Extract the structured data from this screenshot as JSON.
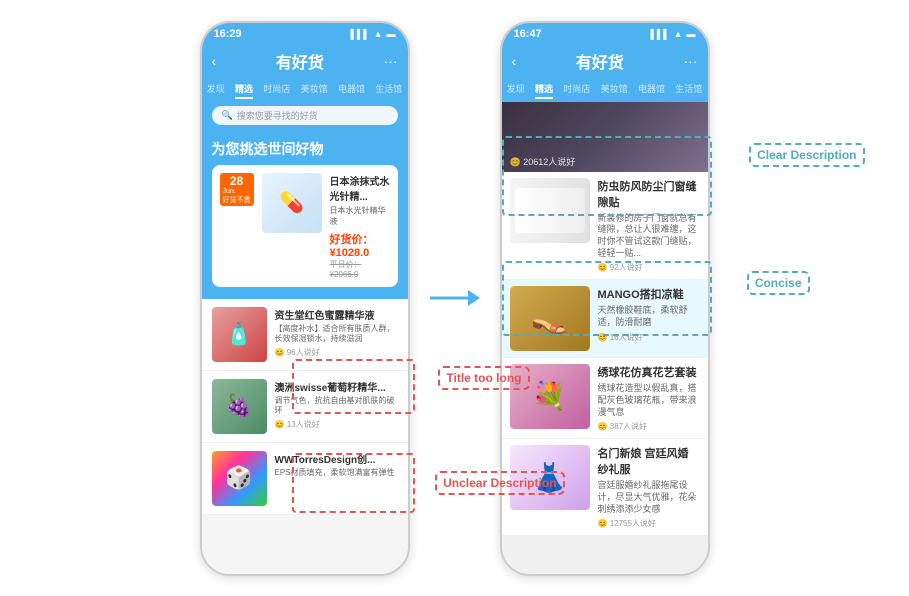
{
  "leftPhone": {
    "statusTime": "16:29",
    "navTitle": "有好货",
    "tabs": [
      "发现",
      "精选",
      "时尚店",
      "美妆馆",
      "电器馆",
      "生活馆"
    ],
    "activeTab": "精选",
    "searchPlaceholder": "搜索您要寻找的好货",
    "heroTitle": "为您挑选世间好物",
    "badge": {
      "day": "28",
      "month": "Jun.",
      "label": "好货不贵"
    },
    "featuredProduct": {
      "name": "日本涂抹式水光针精...",
      "sub": "日本水光针精华液",
      "priceLabel": "好货价：",
      "price": "¥1028.0",
      "originalPrice": "平日价：¥2066.0"
    },
    "products": [
      {
        "name": "资生堂红色蜜露精华液",
        "desc": "【高度补水】适合所有肤质人群，长效保湿锁水，持续滋润",
        "likes": "96人说好",
        "thumbType": "red-bottle",
        "emoji": "🧴"
      },
      {
        "name": "澳洲swisse葡萄籽精华...",
        "desc": "调节气色，抗抗自由基对肌肤的破环",
        "likes": "13人说好",
        "thumbType": "green-bottle",
        "emoji": "🍇"
      },
      {
        "name": "WWTorresDesign创...",
        "desc": "EPS材质填充，柔软饱满富有弹性",
        "likes": "",
        "thumbType": "colorful-cube",
        "emoji": "🎲"
      }
    ],
    "annotations": [
      {
        "text": "Title too long",
        "type": "red"
      },
      {
        "text": "Unclear Description",
        "type": "red"
      }
    ]
  },
  "rightPhone": {
    "statusTime": "16:47",
    "navTitle": "有好货",
    "tabs": [
      "发现",
      "精选",
      "时尚店",
      "美妆馆",
      "电器馆",
      "生活馆"
    ],
    "activeTab": "精选",
    "topImageLikes": "20612人说好",
    "products": [
      {
        "name": "防虫防风防尘门窗缝隙贴",
        "desc": "新装修的房子门窗就总有缝隙，总让人很难缠，这时你不管试这款门缝贴，轻轻一贴...",
        "likes": "92人说好",
        "thumbType": "strip-img"
      },
      {
        "name": "MANGO搭扣凉鞋",
        "desc": "天然橡胶鞋底，柔软舒适，防滑耐磨",
        "likes": "16人说好",
        "thumbType": "sandals-img"
      },
      {
        "name": "绣球花仿真花艺套装",
        "desc": "绣球花造型以假乱真，搭配灰色玻璃花瓶，带来浪漫气息",
        "likes": "387人说好",
        "thumbType": "flowers-img"
      },
      {
        "name": "名门新娘 宫廷风婚纱礼服",
        "desc": "宫廷服婚纱礼服拖尾设计，尽显大气优雅，花朵刺绣添添少女感",
        "likes": "12755人说好",
        "thumbType": "dress-img"
      }
    ],
    "annotations": [
      {
        "text": "Clear Description",
        "type": "cyan"
      },
      {
        "text": "Concise",
        "type": "cyan"
      }
    ]
  },
  "arrow": {
    "label": "→"
  }
}
